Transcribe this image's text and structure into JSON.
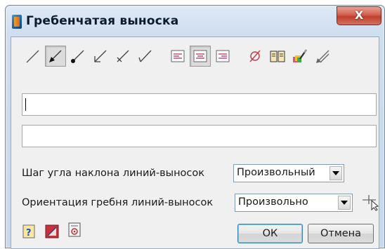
{
  "window": {
    "title": "Гребенчатая выноска",
    "close_label": "X"
  },
  "toolbar": {
    "groups": [
      "leader-type",
      "text-alignment",
      "tools"
    ],
    "items": [
      "leader-straight-icon",
      "leader-arrow-filled-icon",
      "leader-dot-icon",
      "leader-open-arrow-icon",
      "leader-tick-icon",
      "leader-check-icon",
      "align-left-icon",
      "align-center-icon",
      "align-right-icon",
      "diameter-symbol-icon",
      "symbol-library-icon",
      "style-brush-icon",
      "leader-settings-icon"
    ],
    "pressed": [
      "leader-arrow-filled-icon",
      "align-center-icon"
    ]
  },
  "text_field_1": {
    "value": ""
  },
  "text_field_2": {
    "value": ""
  },
  "angle_step": {
    "label": "Шаг угла наклона линий-выносок",
    "value": "Произвольный"
  },
  "comb_orientation": {
    "label": "Ориентация гребня линий-выносок",
    "value": "Произвольно"
  },
  "bottom_icons": [
    "help-icon",
    "layer-style-icon",
    "properties-icon"
  ],
  "buttons": {
    "ok": "ОК",
    "cancel": "Отмена"
  }
}
